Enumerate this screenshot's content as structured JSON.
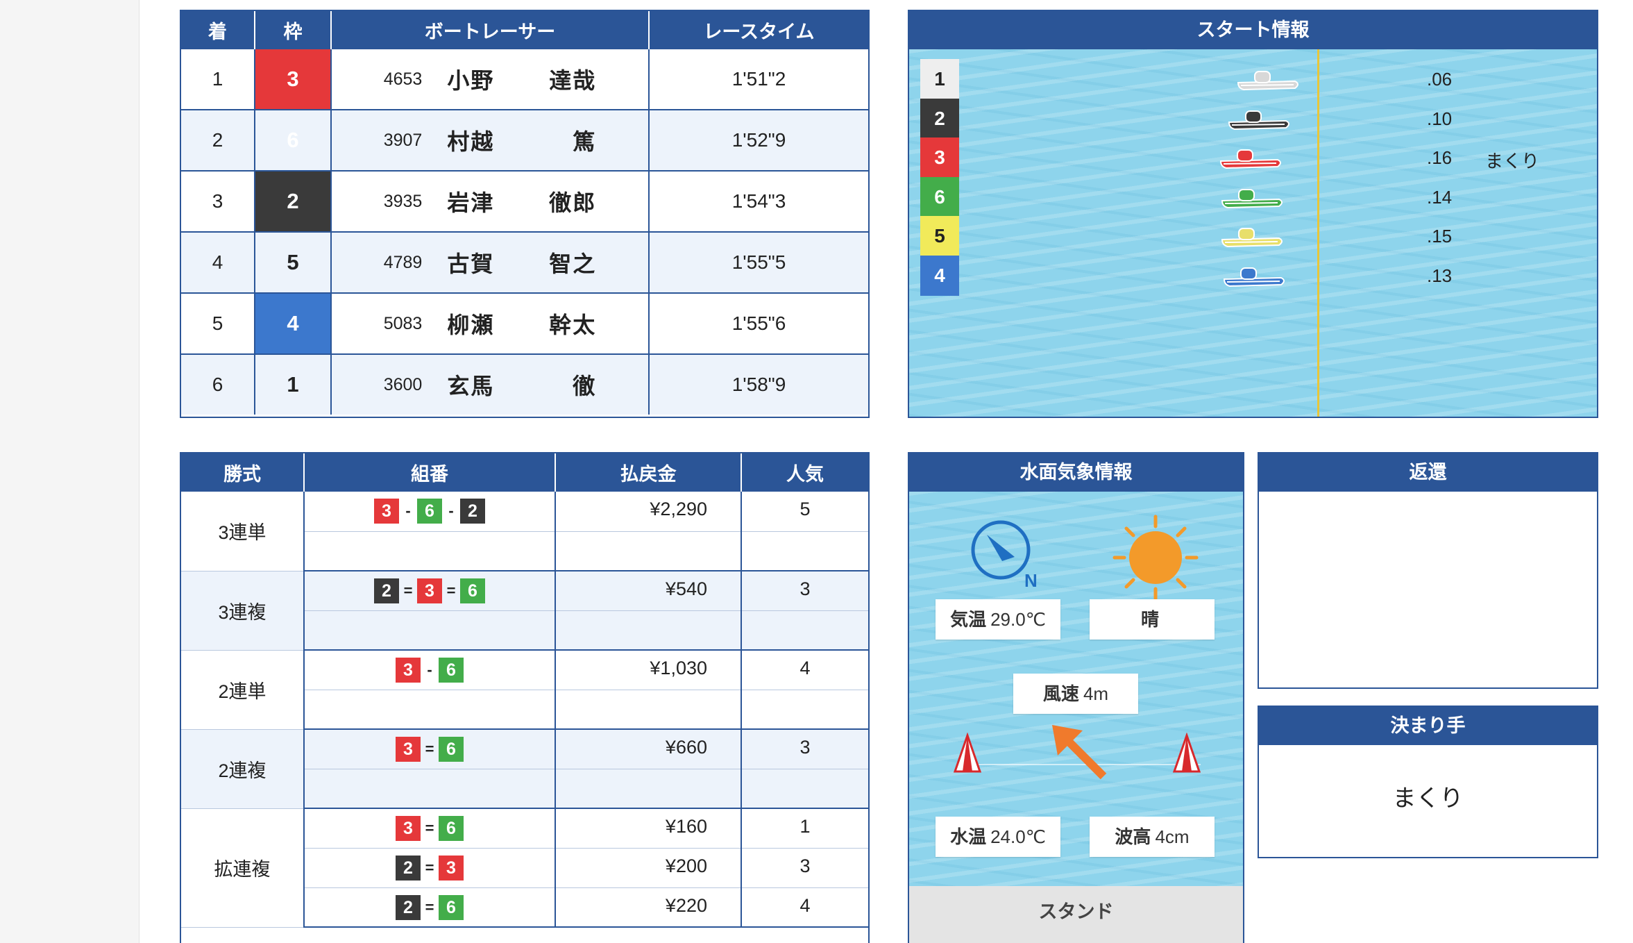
{
  "results": {
    "headers": [
      "着",
      "枠",
      "ボートレーサー",
      "レースタイム"
    ],
    "rows": [
      {
        "place": "1",
        "waku": "3",
        "reg": "4653",
        "last": "小野",
        "first": "達哉",
        "time": "1'51\"2"
      },
      {
        "place": "2",
        "waku": "6",
        "reg": "3907",
        "last": "村越",
        "first": "篤",
        "time": "1'52\"9"
      },
      {
        "place": "3",
        "waku": "2",
        "reg": "3935",
        "last": "岩津",
        "first": "徹郎",
        "time": "1'54\"3"
      },
      {
        "place": "4",
        "waku": "5",
        "reg": "4789",
        "last": "古賀",
        "first": "智之",
        "time": "1'55\"5"
      },
      {
        "place": "5",
        "waku": "4",
        "reg": "5083",
        "last": "柳瀬",
        "first": "幹太",
        "time": "1'55\"6"
      },
      {
        "place": "6",
        "waku": "1",
        "reg": "3600",
        "last": "玄馬",
        "first": "徹",
        "time": "1'58\"9"
      }
    ]
  },
  "start_info": {
    "title": "スタート情報",
    "rows": [
      {
        "waku": "1",
        "timing": ".06",
        "note": "",
        "boat_color": "#d8d8d8"
      },
      {
        "waku": "2",
        "timing": ".10",
        "note": "",
        "boat_color": "#3a3a3a"
      },
      {
        "waku": "3",
        "timing": ".16",
        "note": "まくり",
        "boat_color": "#e5383a"
      },
      {
        "waku": "6",
        "timing": ".14",
        "note": "",
        "boat_color": "#43ad4a"
      },
      {
        "waku": "5",
        "timing": ".15",
        "note": "",
        "boat_color": "#e8df6a"
      },
      {
        "waku": "4",
        "timing": ".13",
        "note": "",
        "boat_color": "#3c78cd"
      }
    ]
  },
  "payouts": {
    "headers": [
      "勝式",
      "組番",
      "払戻金",
      "人気"
    ],
    "groups": [
      {
        "kind": "3連単",
        "rows": [
          {
            "combo": [
              "3",
              "6",
              "2"
            ],
            "sep": "-",
            "amount": "¥2,290",
            "pop": "5"
          }
        ]
      },
      {
        "kind": "3連複",
        "rows": [
          {
            "combo": [
              "2",
              "3",
              "6"
            ],
            "sep": "=",
            "amount": "¥540",
            "pop": "3"
          }
        ]
      },
      {
        "kind": "2連単",
        "rows": [
          {
            "combo": [
              "3",
              "6"
            ],
            "sep": "-",
            "amount": "¥1,030",
            "pop": "4"
          }
        ]
      },
      {
        "kind": "2連複",
        "rows": [
          {
            "combo": [
              "3",
              "6"
            ],
            "sep": "=",
            "amount": "¥660",
            "pop": "3"
          }
        ]
      },
      {
        "kind": "拡連複",
        "rows": [
          {
            "combo": [
              "3",
              "6"
            ],
            "sep": "=",
            "amount": "¥160",
            "pop": "1"
          },
          {
            "combo": [
              "2",
              "3"
            ],
            "sep": "=",
            "amount": "¥200",
            "pop": "3"
          },
          {
            "combo": [
              "2",
              "6"
            ],
            "sep": "=",
            "amount": "¥220",
            "pop": "4"
          }
        ]
      }
    ]
  },
  "weather": {
    "title": "水面気象情報",
    "compass_label": "N",
    "air_label": "気温",
    "air_value": "29.0℃",
    "condition": "晴",
    "wind_label": "風速",
    "wind_value": "4m",
    "water_label": "水温",
    "water_value": "24.0℃",
    "wave_label": "波高",
    "wave_value": "4cm",
    "stand_label": "スタンド"
  },
  "refund": {
    "title": "返還"
  },
  "kimarite": {
    "title": "決まり手",
    "value": "まくり"
  },
  "colors": {
    "header": "#2b5597",
    "waku1": "#eeeeee",
    "waku2": "#3a3a3a",
    "waku3": "#e5383a",
    "waku4": "#3c78cd",
    "waku5": "#f1ea5a",
    "waku6": "#43ad4a"
  }
}
